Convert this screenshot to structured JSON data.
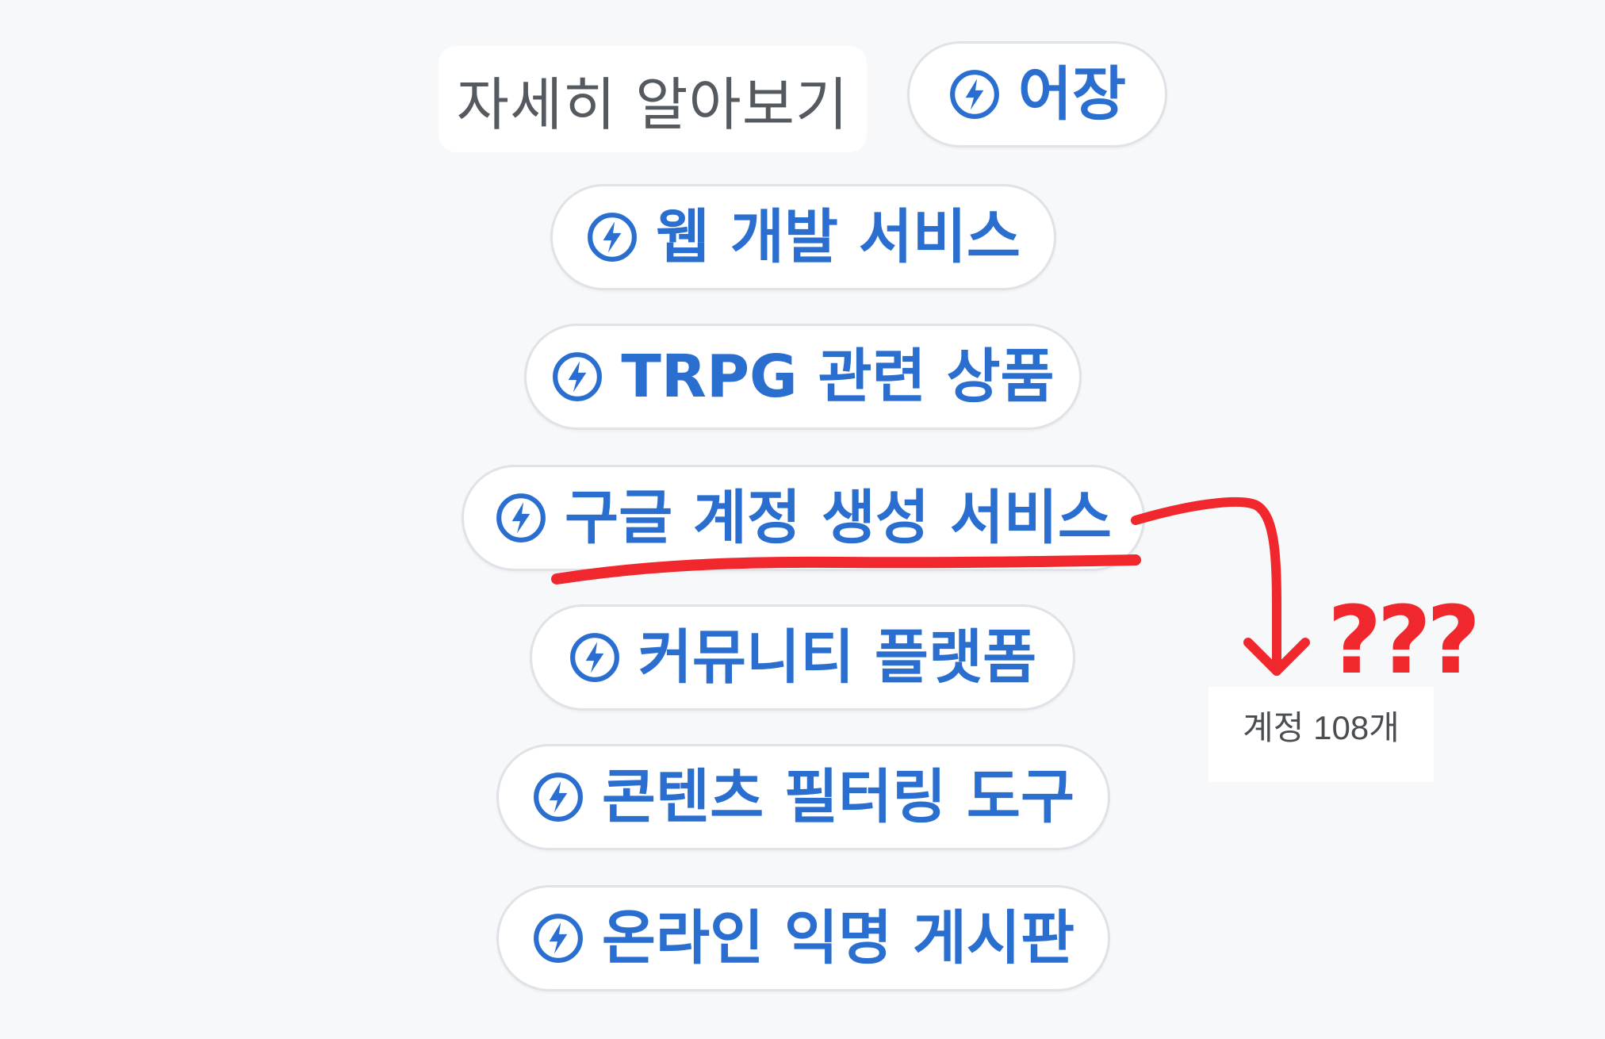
{
  "learn_more": "자세히 알아보기",
  "chips": [
    {
      "label": "어장",
      "icon": "lightning-circle-icon"
    },
    {
      "label": "웹 개발 서비스",
      "icon": "lightning-circle-icon"
    },
    {
      "label": "TRPG 관련 상품",
      "icon": "lightning-circle-icon"
    },
    {
      "label": "구글 계정 생성 서비스",
      "icon": "lightning-circle-icon"
    },
    {
      "label": "커뮤니티 플랫폼",
      "icon": "lightning-circle-icon"
    },
    {
      "label": "콘텐츠 필터링 도구",
      "icon": "lightning-circle-icon"
    },
    {
      "label": "온라인 익명 게시판",
      "icon": "lightning-circle-icon"
    }
  ],
  "annotation": {
    "marks": "???",
    "count_text": "계정 108개",
    "color": "#f0282d"
  },
  "colors": {
    "accent": "#2a6fd0",
    "background": "#f7f8fa",
    "chip_border": "#dfe2e6",
    "muted_text": "#555a60"
  }
}
